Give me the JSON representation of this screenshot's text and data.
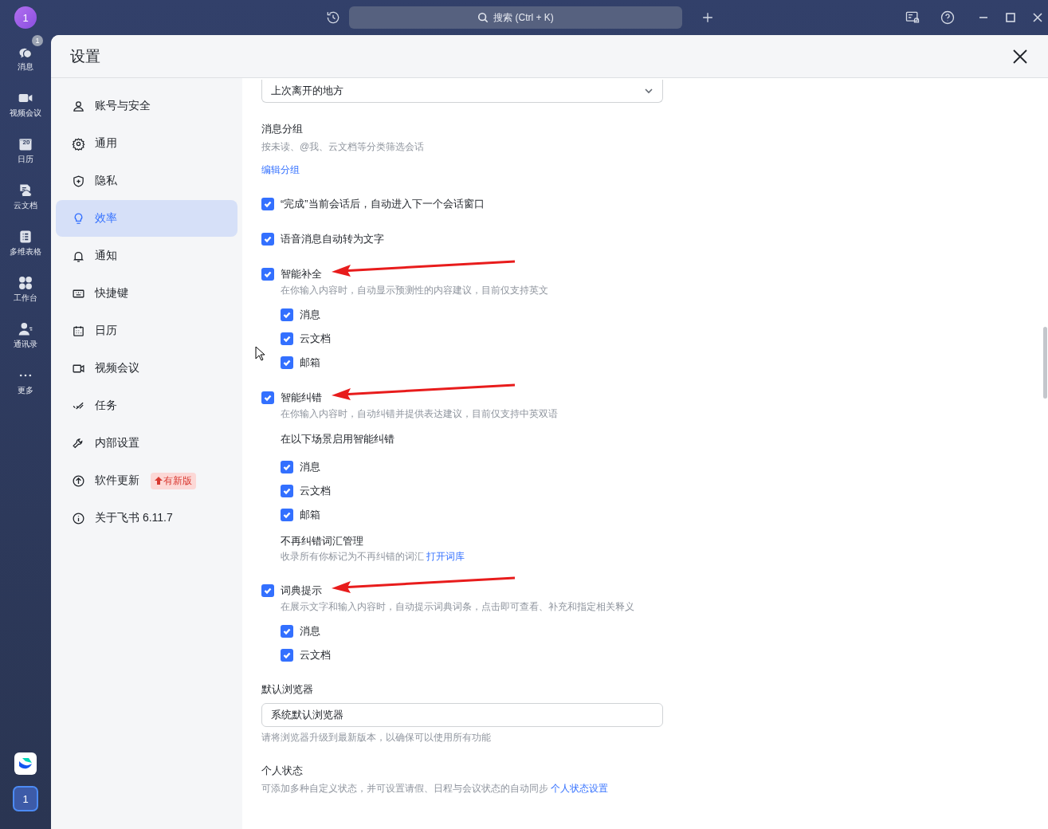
{
  "rail": {
    "avatar": "1",
    "items": [
      {
        "label": "消息",
        "badge": "1"
      },
      {
        "label": "视频会议"
      },
      {
        "label": "日历",
        "date": "20"
      },
      {
        "label": "云文档"
      },
      {
        "label": "多维表格"
      },
      {
        "label": "工作台"
      },
      {
        "label": "通讯录"
      },
      {
        "label": "更多"
      }
    ],
    "workspace": "1"
  },
  "topbar": {
    "search_placeholder": "搜索 (Ctrl + K)"
  },
  "settings": {
    "title": "设置",
    "nav": [
      {
        "label": "账号与安全",
        "selected": false
      },
      {
        "label": "通用",
        "selected": false
      },
      {
        "label": "隐私",
        "selected": false
      },
      {
        "label": "效率",
        "selected": true
      },
      {
        "label": "通知",
        "selected": false
      },
      {
        "label": "快捷键",
        "selected": false
      },
      {
        "label": "日历",
        "selected": false
      },
      {
        "label": "视频会议",
        "selected": false
      },
      {
        "label": "任务",
        "selected": false
      },
      {
        "label": "内部设置",
        "selected": false
      },
      {
        "label": "软件更新",
        "selected": false,
        "badge": "有新版"
      },
      {
        "label": "关于飞书 6.11.7",
        "selected": false
      }
    ],
    "content": [
      {
        "kind": "select",
        "value": "上次离开的地方"
      },
      {
        "kind": "setting",
        "title": "消息分组",
        "description": "按未读、@我、云文档等分类筛选会话",
        "action_link": "编辑分组"
      },
      {
        "kind": "check",
        "label": "“完成”当前会话后，自动进入下一个会话窗口",
        "checked": true,
        "marked": false
      },
      {
        "kind": "check",
        "label": "语音消息自动转为文字",
        "checked": true,
        "marked": false
      },
      {
        "kind": "check",
        "label": "智能补全",
        "checked": true,
        "marked": true,
        "description": "在你输入内容时，自动显示预测性的内容建议，目前仅支持英文",
        "children": [
          {
            "kind": "option",
            "label": "消息",
            "checked": true
          },
          {
            "kind": "option",
            "label": "云文档",
            "checked": true
          },
          {
            "kind": "option",
            "label": "邮箱",
            "checked": true
          }
        ]
      },
      {
        "kind": "check",
        "label": "智能纠错",
        "checked": true,
        "marked": true,
        "description": "在你输入内容时，自动纠错并提供表达建议，目前仅支持中英双语",
        "children": [
          {
            "kind": "heading",
            "label": "在以下场景启用智能纠错"
          },
          {
            "kind": "option",
            "label": "消息",
            "checked": true
          },
          {
            "kind": "option",
            "label": "云文档",
            "checked": true
          },
          {
            "kind": "option",
            "label": "邮箱",
            "checked": true
          },
          {
            "kind": "setting",
            "title": "不再纠错词汇管理",
            "description": "收录所有你标记为不再纠错的词汇",
            "link": "打开词库"
          }
        ]
      },
      {
        "kind": "check",
        "label": "词典提示",
        "checked": true,
        "marked": true,
        "description": "在展示文字和输入内容时，自动提示词典词条，点击即可查看、补充和指定相关释义",
        "children": [
          {
            "kind": "option",
            "label": "消息",
            "checked": true
          },
          {
            "kind": "option",
            "label": "云文档",
            "checked": true
          }
        ]
      },
      {
        "kind": "setting",
        "title": "默认浏览器",
        "select": "系统默认浏览器",
        "description": "请将浏览器升级到最新版本，以确保可以使用所有功能"
      },
      {
        "kind": "setting",
        "title": "个人状态",
        "description": "可添加多种自定义状态，并可设置请假、日程与会议状态的自动同步",
        "link": "个人状态设置"
      }
    ]
  }
}
